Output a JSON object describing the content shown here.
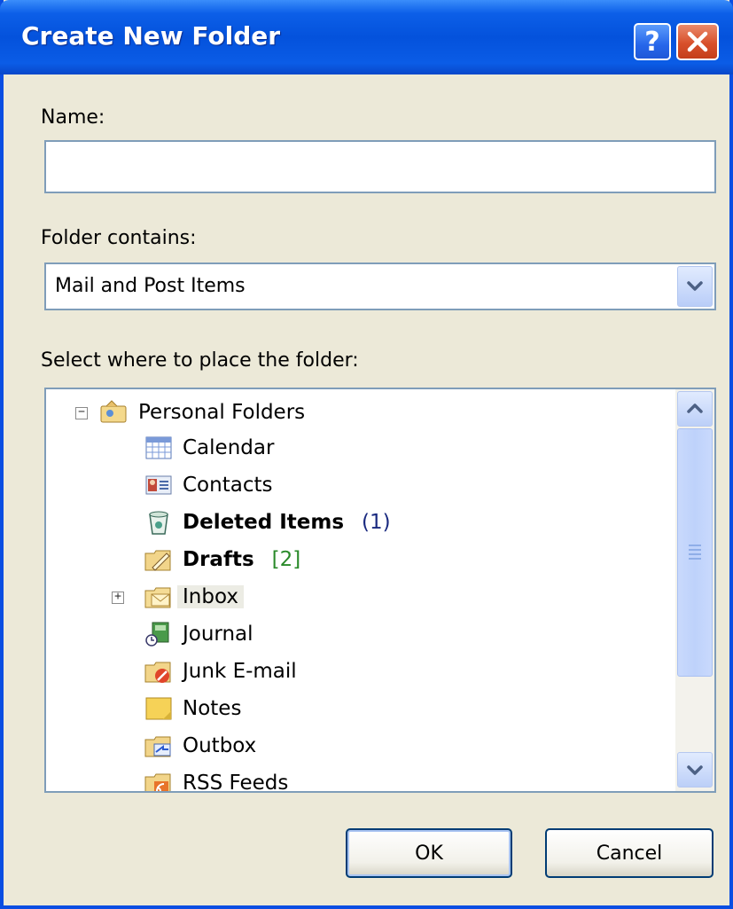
{
  "window": {
    "title": "Create New Folder"
  },
  "titlebar_buttons": {
    "help": "?",
    "close": "X"
  },
  "name_field": {
    "label": "Name:",
    "value": ""
  },
  "folder_contains": {
    "label": "Folder contains:",
    "selected": "Mail and Post Items"
  },
  "tree": {
    "label": "Select where to place the folder:",
    "root": "Personal Folders",
    "items": [
      {
        "label": "Calendar",
        "count": "",
        "icon": "calendar-icon"
      },
      {
        "label": "Contacts",
        "count": "",
        "icon": "contacts-icon"
      },
      {
        "label": "Deleted Items",
        "count": "(1)",
        "icon": "deleted-items-icon"
      },
      {
        "label": "Drafts",
        "count": "[2]",
        "icon": "drafts-icon"
      },
      {
        "label": "Inbox",
        "count": "",
        "icon": "inbox-icon"
      },
      {
        "label": "Journal",
        "count": "",
        "icon": "journal-icon"
      },
      {
        "label": "Junk E-mail",
        "count": "",
        "icon": "junk-email-icon"
      },
      {
        "label": "Notes",
        "count": "",
        "icon": "notes-icon"
      },
      {
        "label": "Outbox",
        "count": "",
        "icon": "outbox-icon"
      },
      {
        "label": "RSS Feeds",
        "count": "",
        "icon": "rss-feeds-icon"
      }
    ]
  },
  "buttons": {
    "ok": "OK",
    "cancel": "Cancel"
  },
  "colors": {
    "titlebar": "#0452dc",
    "face": "#ece9d8",
    "close": "#d8502b"
  }
}
